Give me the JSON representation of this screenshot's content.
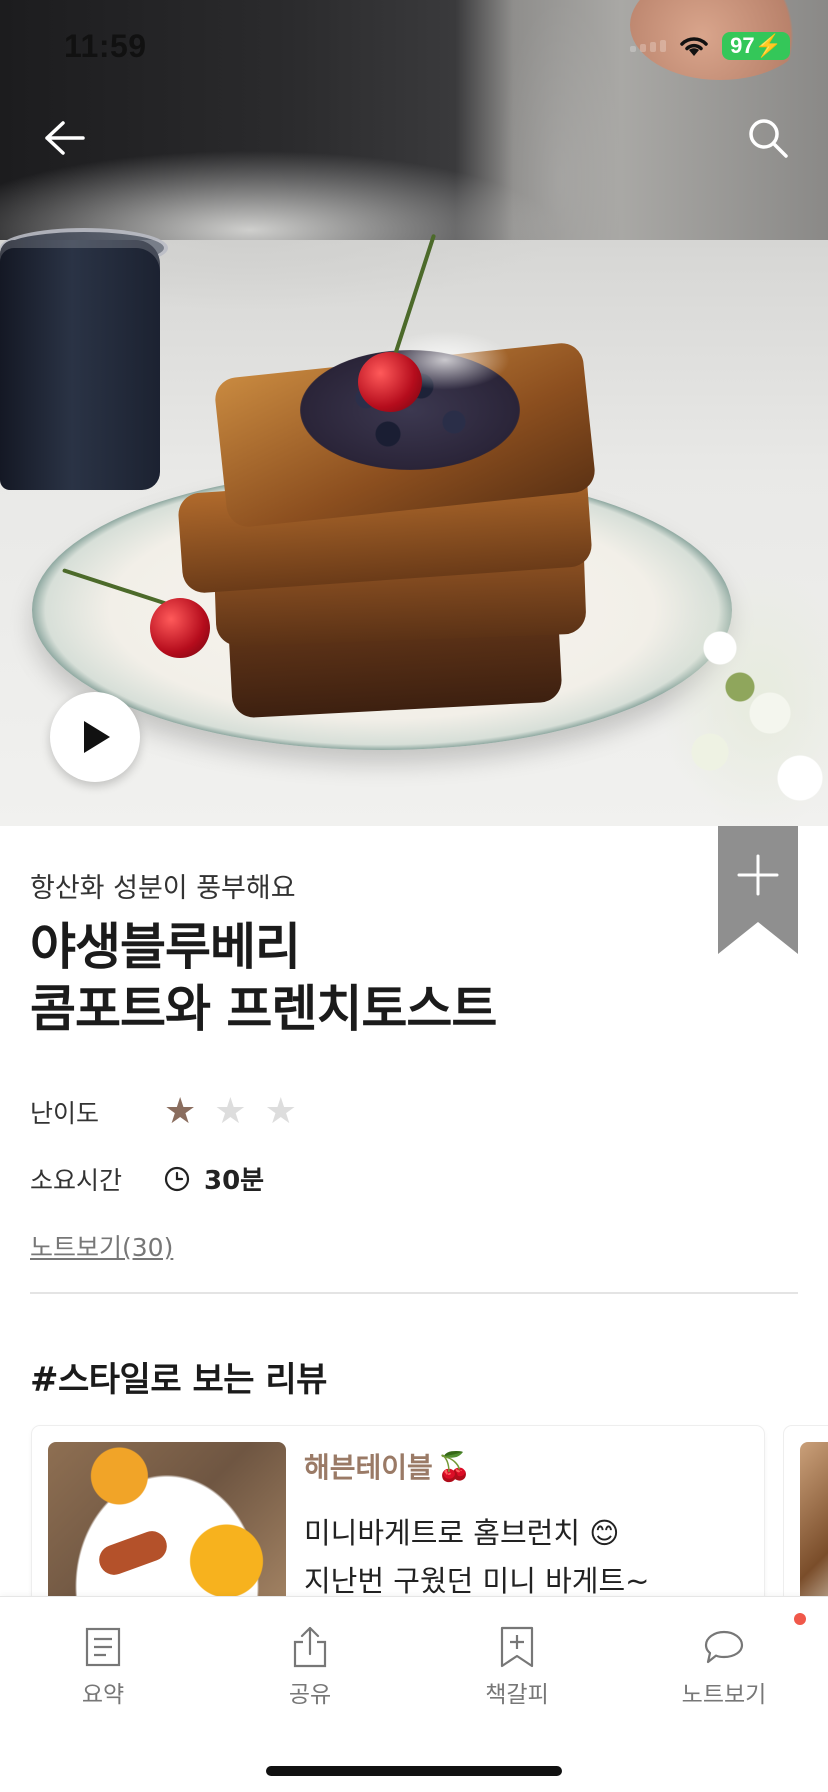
{
  "status_bar": {
    "time": "11:59",
    "battery": "97"
  },
  "hero": {
    "alt": "블루베리 프렌치토스트 사진"
  },
  "nav": {
    "back_icon": "arrow-left-icon",
    "search_icon": "search-icon",
    "play_icon": "play-icon"
  },
  "recipe": {
    "subtitle": "항산화 성분이 풍부해요",
    "title_line1": "야생블루베리",
    "title_line2": "콤포트와 프렌치토스트",
    "difficulty_label": "난이도",
    "difficulty_rating": 1,
    "difficulty_max": 3,
    "time_label": "소요시간",
    "time_value": "30분",
    "notes_link": "노트보기(30)"
  },
  "reviews": {
    "section_title": "#스타일로 보는 리뷰",
    "items": [
      {
        "author": "해븐테이블",
        "emoji": "🍒",
        "line1": "미니바게트로 홈브런치 😊",
        "line2": "지난번 구웠던 미니 바게트~"
      }
    ]
  },
  "bottom_tabs": [
    {
      "label": "요약",
      "icon": "document-icon"
    },
    {
      "label": "공유",
      "icon": "share-icon"
    },
    {
      "label": "책갈피",
      "icon": "bookmark-add-icon"
    },
    {
      "label": "노트보기",
      "icon": "chat-bubble-icon"
    }
  ],
  "colors": {
    "accent_brown": "#8a6d5e",
    "ribbon": "#8f8f8f",
    "battery": "#34c759",
    "notification": "#f0584a"
  }
}
